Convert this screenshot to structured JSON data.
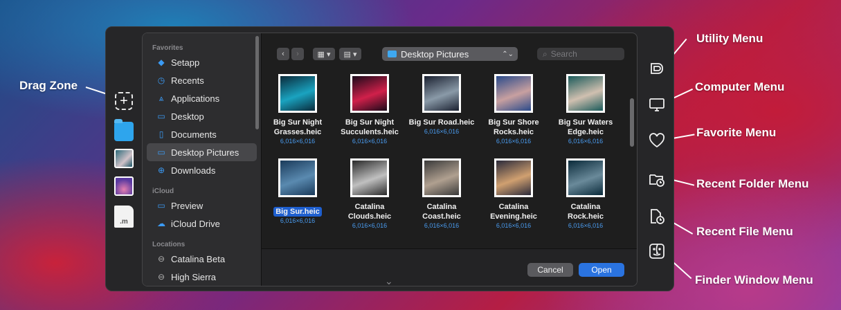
{
  "callouts": {
    "drag_zone": "Drag Zone",
    "utility_menu": "Utility Menu",
    "computer_menu": "Computer Menu",
    "favorite_menu": "Favorite Menu",
    "recent_folder_menu": "Recent Folder Menu",
    "recent_file_menu": "Recent File Menu",
    "finder_window_menu": "Finder Window Menu"
  },
  "left_strip": {
    "file_label": ".m"
  },
  "sidebar": {
    "favorites_header": "Favorites",
    "favorites": [
      {
        "label": "Setapp",
        "icon": "setapp-icon"
      },
      {
        "label": "Recents",
        "icon": "clock-icon"
      },
      {
        "label": "Applications",
        "icon": "applications-icon"
      },
      {
        "label": "Desktop",
        "icon": "desktop-icon"
      },
      {
        "label": "Documents",
        "icon": "document-icon"
      },
      {
        "label": "Desktop Pictures",
        "icon": "folder-icon"
      },
      {
        "label": "Downloads",
        "icon": "download-icon"
      }
    ],
    "icloud_header": "iCloud",
    "icloud": [
      {
        "label": "Preview",
        "icon": "folder-icon"
      },
      {
        "label": "iCloud Drive",
        "icon": "cloud-icon"
      }
    ],
    "locations_header": "Locations",
    "locations": [
      {
        "label": "Catalina Beta",
        "icon": "disk-icon"
      },
      {
        "label": "High Sierra",
        "icon": "disk-icon"
      }
    ]
  },
  "toolbar": {
    "path": "Desktop Pictures",
    "search_placeholder": "Search"
  },
  "files": [
    {
      "name": "Big Sur Night Grasses.heic",
      "line1": "Big Sur Night",
      "line2": "Grasses.heic",
      "dims": "6,016×6,016",
      "colors": [
        "#0a2a3a",
        "#1aa3c0"
      ]
    },
    {
      "name": "Big Sur Night Succulents.heic",
      "line1": "Big Sur Night",
      "line2": "Succulents.heic",
      "dims": "6,016×6,016",
      "colors": [
        "#1a0a1a",
        "#d0204a"
      ]
    },
    {
      "name": "Big Sur Road.heic",
      "line1": "Big Sur Road.heic",
      "line2": "",
      "dims": "6,016×6,016",
      "colors": [
        "#1a2030",
        "#8a9aa8"
      ]
    },
    {
      "name": "Big Sur Shore Rocks.heic",
      "line1": "Big Sur Shore",
      "line2": "Rocks.heic",
      "dims": "6,016×6,016",
      "colors": [
        "#2a4a8a",
        "#c8a0a0"
      ]
    },
    {
      "name": "Big Sur Waters Edge.heic",
      "line1": "Big Sur Waters",
      "line2": "Edge.heic",
      "dims": "6,016×6,016",
      "colors": [
        "#1a5a5a",
        "#d0c0b0"
      ]
    },
    {
      "name": "Big Sur.heic",
      "line1": "Big Sur.heic",
      "line2": "",
      "dims": "6,016×6,016",
      "colors": [
        "#1a3a5a",
        "#5a8ab0"
      ],
      "selected": true
    },
    {
      "name": "Catalina Clouds.heic",
      "line1": "Catalina",
      "line2": "Clouds.heic",
      "dims": "6,016×6,016",
      "colors": [
        "#2a2a2a",
        "#c0c0c0"
      ]
    },
    {
      "name": "Catalina Coast.heic",
      "line1": "Catalina",
      "line2": "Coast.heic",
      "dims": "6,016×6,016",
      "colors": [
        "#3a3a3a",
        "#b0a090"
      ]
    },
    {
      "name": "Catalina Evening.heic",
      "line1": "Catalina",
      "line2": "Evening.heic",
      "dims": "6,016×6,016",
      "colors": [
        "#2a2a3a",
        "#d0a070"
      ]
    },
    {
      "name": "Catalina Rock.heic",
      "line1": "Catalina",
      "line2": "Rock.heic",
      "dims": "6,016×6,016",
      "colors": [
        "#0a2a3a",
        "#6a8a9a"
      ]
    }
  ],
  "buttons": {
    "cancel": "Cancel",
    "open": "Open"
  },
  "colors": {
    "accent": "#2a73e0",
    "selection": "#1e5fcf",
    "dims_text": "#4a9cf0"
  }
}
